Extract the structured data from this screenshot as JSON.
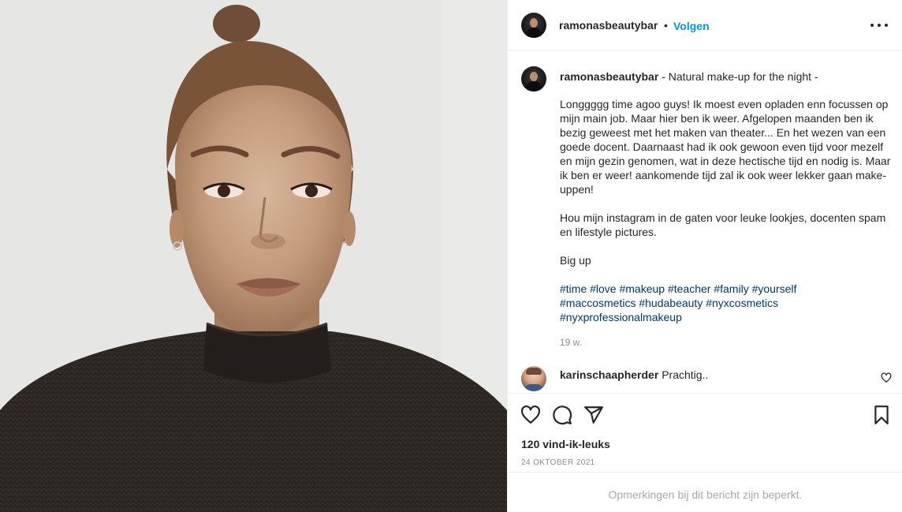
{
  "post": {
    "username": "ramonasbeautybar",
    "dot": "•",
    "follow_label": "Volgen",
    "more_icon": "more-horizontal-icon"
  },
  "caption": {
    "username": "ramonasbeautybar",
    "title": " - Natural make-up for the night -",
    "paragraphs": [
      "Longgggg time agoo guys! Ik moest even opladen enn focussen op mijn main job. Maar hier ben ik weer. Afgelopen maanden ben ik bezig geweest met het maken van theater... En het wezen van een goede docent. Daarnaast had ik ook gewoon even tijd voor mezelf en mijn gezin genomen, wat in deze hectische tijd en nodig is. Maar ik ben er weer! aankomende tijd zal ik ook weer lekker gaan make-uppen!",
      "Hou mijn instagram in de gaten voor leuke lookjes, docenten spam en lifestyle pictures.",
      "Big up"
    ],
    "hashtags": [
      "#time",
      "#love",
      "#makeup",
      "#teacher",
      "#family",
      "#yourself",
      "#maccosmetics",
      "#hudabeauty",
      "#nyxcosmetics",
      "#nyxprofessionalmakeup"
    ],
    "age": "19 w."
  },
  "comments": [
    {
      "username": "karinschaapherder",
      "text": "Prachtig.."
    }
  ],
  "actions": {
    "likes": "120 vind-ik-leuks",
    "date": "24 OKTOBER 2021",
    "icons": [
      "heart-icon",
      "comment-icon",
      "share-icon",
      "bookmark-icon"
    ]
  },
  "footer": {
    "text": "Opmerkingen bij dit bericht zijn beperkt."
  },
  "colors": {
    "accent": "#0095f6",
    "hashtag": "#00376b",
    "muted": "#8e8e8e",
    "text": "#262626"
  }
}
